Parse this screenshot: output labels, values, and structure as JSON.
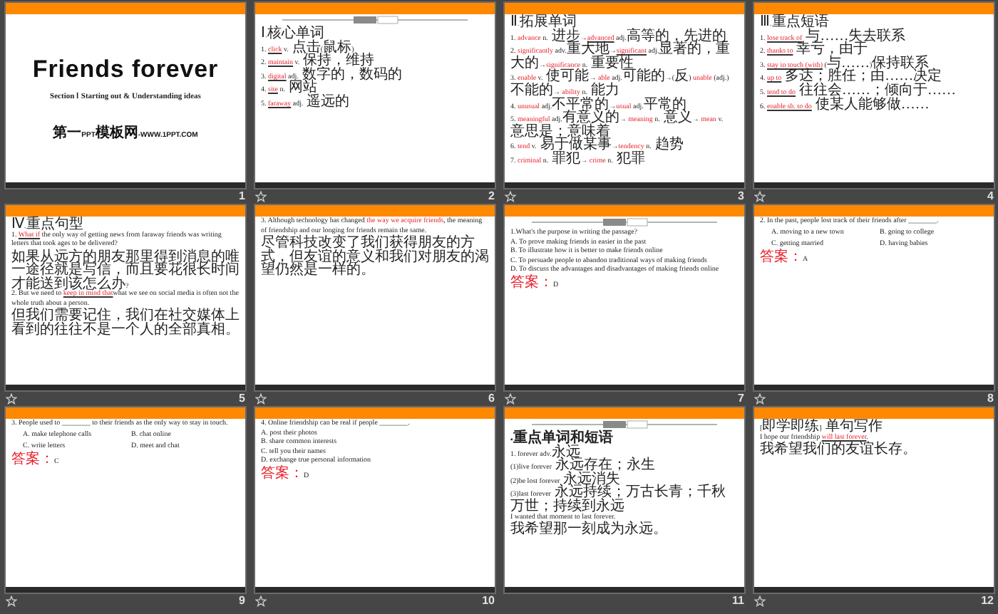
{
  "slides": [
    {
      "number": "1",
      "transition_icon": false,
      "kind": "title",
      "title": "Friends  forever",
      "subtitle": "Section Ⅰ Starting out & Understanding ideas",
      "footer": "第一PPT模板网-WWW.1PPT.COM"
    },
    {
      "number": "2",
      "transition_icon": true,
      "kind": "content",
      "header_rule": true,
      "lines": [
        {
          "kind": "text",
          "parts": [
            "Ⅰ.核心单词"
          ]
        },
        {
          "kind": "text",
          "parts": [
            "1. ",
            {
              "text": "click",
              "kind": "answer"
            },
            " v. 点击(鼠标)"
          ]
        },
        {
          "kind": "text",
          "parts": [
            "2. ",
            {
              "text": "maintain",
              "kind": "answer"
            },
            " v. 保持，维持"
          ]
        },
        {
          "kind": "text",
          "parts": [
            "3. ",
            {
              "text": "digital",
              "kind": "answer"
            },
            " adj. 数字的，数码的"
          ]
        },
        {
          "kind": "text",
          "parts": [
            "4. ",
            {
              "text": "site",
              "kind": "answer"
            },
            " n. 网站"
          ]
        },
        {
          "kind": "text",
          "parts": [
            "5. ",
            {
              "text": "faraway",
              "kind": "answer"
            },
            " adj. 遥远的"
          ]
        }
      ]
    },
    {
      "number": "3",
      "transition_icon": true,
      "kind": "content",
      "header_rule": false,
      "lines": [
        {
          "kind": "text",
          "parts": [
            "Ⅱ.拓展单词"
          ]
        },
        {
          "kind": "text",
          "parts": [
            "1. ",
            {
              "text": "advance",
              "kind": "red"
            },
            " n. 进步→",
            {
              "text": "advanced",
              "kind": "answer"
            },
            " adj.高等的，先进的"
          ]
        },
        {
          "kind": "text",
          "parts": [
            "2. ",
            {
              "text": "significantly",
              "kind": "red"
            },
            " adv.重大地→",
            {
              "text": "significant",
              "kind": "answer"
            },
            " adj.显著的，重大的→",
            {
              "text": "significance",
              "kind": "red"
            },
            " n. 重要性"
          ]
        },
        {
          "kind": "text",
          "parts": [
            "3. ",
            {
              "text": "enable",
              "kind": "red"
            },
            " v. 使可能→ ",
            {
              "text": "able",
              "kind": "red"
            },
            " adj.可能的→(反) ",
            {
              "text": "unable",
              "kind": "red"
            },
            " (adj.)不能的→ ",
            {
              "text": "ability",
              "kind": "red"
            },
            " n. 能力"
          ]
        },
        {
          "kind": "text",
          "parts": [
            "4. ",
            {
              "text": "unusual",
              "kind": "red"
            },
            " adj.不平常的→",
            {
              "text": "usual",
              "kind": "red"
            },
            " adj.平常的"
          ]
        },
        {
          "kind": "text",
          "parts": [
            "5. ",
            {
              "text": "meaningful",
              "kind": "red"
            },
            " adj.有意义的→ ",
            {
              "text": "meaning",
              "kind": "red"
            },
            " n. 意义→ ",
            {
              "text": "mean",
              "kind": "red"
            },
            " v. 意思是；意味着"
          ]
        },
        {
          "kind": "text",
          "parts": [
            "6. ",
            {
              "text": "tend",
              "kind": "red"
            },
            " v. 易于做某事→",
            {
              "text": "tendency",
              "kind": "red"
            },
            " n. 趋势"
          ]
        },
        {
          "kind": "text",
          "parts": [
            "7. ",
            {
              "text": "criminal",
              "kind": "red"
            },
            " n. 罪犯→ ",
            {
              "text": "crime",
              "kind": "red"
            },
            " n. 犯罪"
          ]
        }
      ]
    },
    {
      "number": "4",
      "transition_icon": true,
      "kind": "content",
      "header_rule": false,
      "lines": [
        {
          "kind": "text",
          "parts": [
            "Ⅲ.重点短语"
          ]
        },
        {
          "kind": "text",
          "parts": [
            "1. ",
            {
              "text": "lose track of",
              "kind": "answer"
            },
            " 与……失去联系"
          ]
        },
        {
          "kind": "text",
          "parts": [
            "2. ",
            {
              "text": "thanks to",
              "kind": "answer"
            },
            " 幸亏，由于"
          ]
        },
        {
          "kind": "text",
          "parts": [
            "3. ",
            {
              "text": "stay in touch (with)",
              "kind": "answer"
            },
            " (与……)保持联系"
          ]
        },
        {
          "kind": "text",
          "parts": [
            "4. ",
            {
              "text": "up to",
              "kind": "answer"
            },
            " 多达；胜任；由……决定"
          ]
        },
        {
          "kind": "text",
          "parts": [
            "5. ",
            {
              "text": "tend to do",
              "kind": "answer"
            },
            " 往往会……；倾向于……"
          ]
        },
        {
          "kind": "text",
          "parts": [
            "6. ",
            {
              "text": "enable sb. to do",
              "kind": "answer"
            },
            " 使某人能够做……"
          ]
        }
      ]
    },
    {
      "number": "5",
      "transition_icon": true,
      "kind": "content",
      "header_rule": false,
      "lines": [
        {
          "kind": "text",
          "parts": [
            "Ⅳ.重点句型"
          ]
        },
        {
          "kind": "text",
          "parts": [
            "1. ",
            {
              "text": "What if",
              "kind": "answer"
            },
            " the only way of getting news from faraway friends was writing letters that took ages to be delivered?"
          ]
        },
        {
          "kind": "text",
          "parts": [
            "如果从远方的朋友那里得到消息的唯一途径就是写信，而且要花很长时间才能送到该怎么办?"
          ]
        },
        {
          "kind": "text",
          "parts": [
            "2. But we need to ",
            {
              "text": "keep in mind that",
              "kind": "answer"
            },
            "what we see on social media is often not the whole truth about a person."
          ]
        },
        {
          "kind": "text",
          "parts": [
            "但我们需要记住，我们在社交媒体上看到的往往不是一个人的全部真相。"
          ]
        }
      ]
    },
    {
      "number": "6",
      "transition_icon": true,
      "kind": "content",
      "header_rule": false,
      "lines": [
        {
          "kind": "text",
          "parts": [
            "3. Although technology has changed ",
            {
              "text": "the way we acquire friends",
              "kind": "red"
            },
            ", the meaning of friendship and our longing for friends remain the same."
          ]
        },
        {
          "kind": "text",
          "parts": [
            "尽管科技改变了我们获得朋友的方式，但友谊的意义和我们对朋友的渴望仍然是一样的。"
          ]
        }
      ]
    },
    {
      "number": "7",
      "transition_icon": true,
      "kind": "content",
      "header_rule": true,
      "lines": [
        {
          "kind": "text",
          "parts": [
            "1.What's the purpose in writing the passage?"
          ]
        },
        {
          "kind": "text",
          "parts": [
            "A. To prove making friends in easier in the past"
          ]
        },
        {
          "kind": "text",
          "parts": [
            "B. To illustrate how it is better to make friends online"
          ]
        },
        {
          "kind": "text",
          "parts": [
            "C. To persuade people to abandon traditional ways of making friends"
          ]
        },
        {
          "kind": "text",
          "parts": [
            "D. To discuss the advantages and disadvantages of making friends online"
          ]
        },
        {
          "kind": "text",
          "parts": [
            {
              "text": "答案：",
              "kind": "red"
            },
            "D"
          ]
        }
      ]
    },
    {
      "number": "8",
      "transition_icon": true,
      "kind": "content",
      "header_rule": false,
      "lines": [
        {
          "kind": "text",
          "parts": [
            "2. In the past, people lost track of their friends after ________."
          ]
        },
        {
          "kind": "options",
          "cells": [
            "A. moving to a new town",
            "B. going to college"
          ]
        },
        {
          "kind": "options",
          "cells": [
            "C. getting married",
            "D. having babies"
          ]
        },
        {
          "kind": "text",
          "parts": [
            {
              "text": "答案：",
              "kind": "red"
            },
            "A"
          ]
        }
      ]
    },
    {
      "number": "9",
      "transition_icon": true,
      "kind": "content",
      "header_rule": false,
      "lines": [
        {
          "kind": "text",
          "parts": [
            "3. People used to ________ to their friends as the only way to stay in touch."
          ]
        },
        {
          "kind": "options",
          "cells": [
            "A. make telephone calls",
            "B. chat online"
          ]
        },
        {
          "kind": "options",
          "cells": [
            "C. write letters",
            "D. meet and chat"
          ]
        },
        {
          "kind": "text",
          "parts": [
            {
              "text": "答案：",
              "kind": "red"
            },
            "C"
          ]
        }
      ]
    },
    {
      "number": "10",
      "transition_icon": true,
      "kind": "content",
      "header_rule": false,
      "lines": [
        {
          "kind": "text",
          "parts": [
            "4. Online friendship can be real if people ________."
          ]
        },
        {
          "kind": "text",
          "parts": [
            "A. post their photos"
          ]
        },
        {
          "kind": "text",
          "parts": [
            "B. share common interests"
          ]
        },
        {
          "kind": "text",
          "parts": [
            "C. tell you their names"
          ]
        },
        {
          "kind": "text",
          "parts": [
            "D. exchange true personal information"
          ]
        },
        {
          "kind": "text",
          "parts": [
            {
              "text": "答案：",
              "kind": "red"
            },
            "D"
          ]
        }
      ]
    },
    {
      "number": "11",
      "transition_icon": false,
      "kind": "content",
      "header_rule": true,
      "lines": [
        {
          "kind": "heading",
          "parts": [
            "▪重点单词和短语"
          ]
        },
        {
          "kind": "text",
          "parts": [
            "1. forever adv.永远"
          ]
        },
        {
          "kind": "text",
          "parts": [
            "(1)live forever 永远存在；永生"
          ]
        },
        {
          "kind": "text",
          "parts": [
            "(2)be lost forever 永远消失"
          ]
        },
        {
          "kind": "text",
          "parts": [
            "(3)last forever 永远持续；万古长青；千秋万世；持续到永远"
          ]
        },
        {
          "kind": "text",
          "parts": [
            "I wanted that moment to last forever."
          ]
        },
        {
          "kind": "text",
          "parts": [
            "我希望那一刻成为永远。"
          ]
        }
      ]
    },
    {
      "number": "12",
      "transition_icon": true,
      "kind": "content",
      "header_rule": false,
      "lines": [
        {
          "kind": "text",
          "parts": [
            "[即学即练] 单句写作"
          ]
        },
        {
          "kind": "text",
          "parts": [
            "I hope our friendship ",
            {
              "text": "will last forever",
              "kind": "answer"
            },
            "."
          ]
        },
        {
          "kind": "text",
          "parts": [
            "我希望我们的友谊长存。"
          ]
        }
      ]
    }
  ]
}
